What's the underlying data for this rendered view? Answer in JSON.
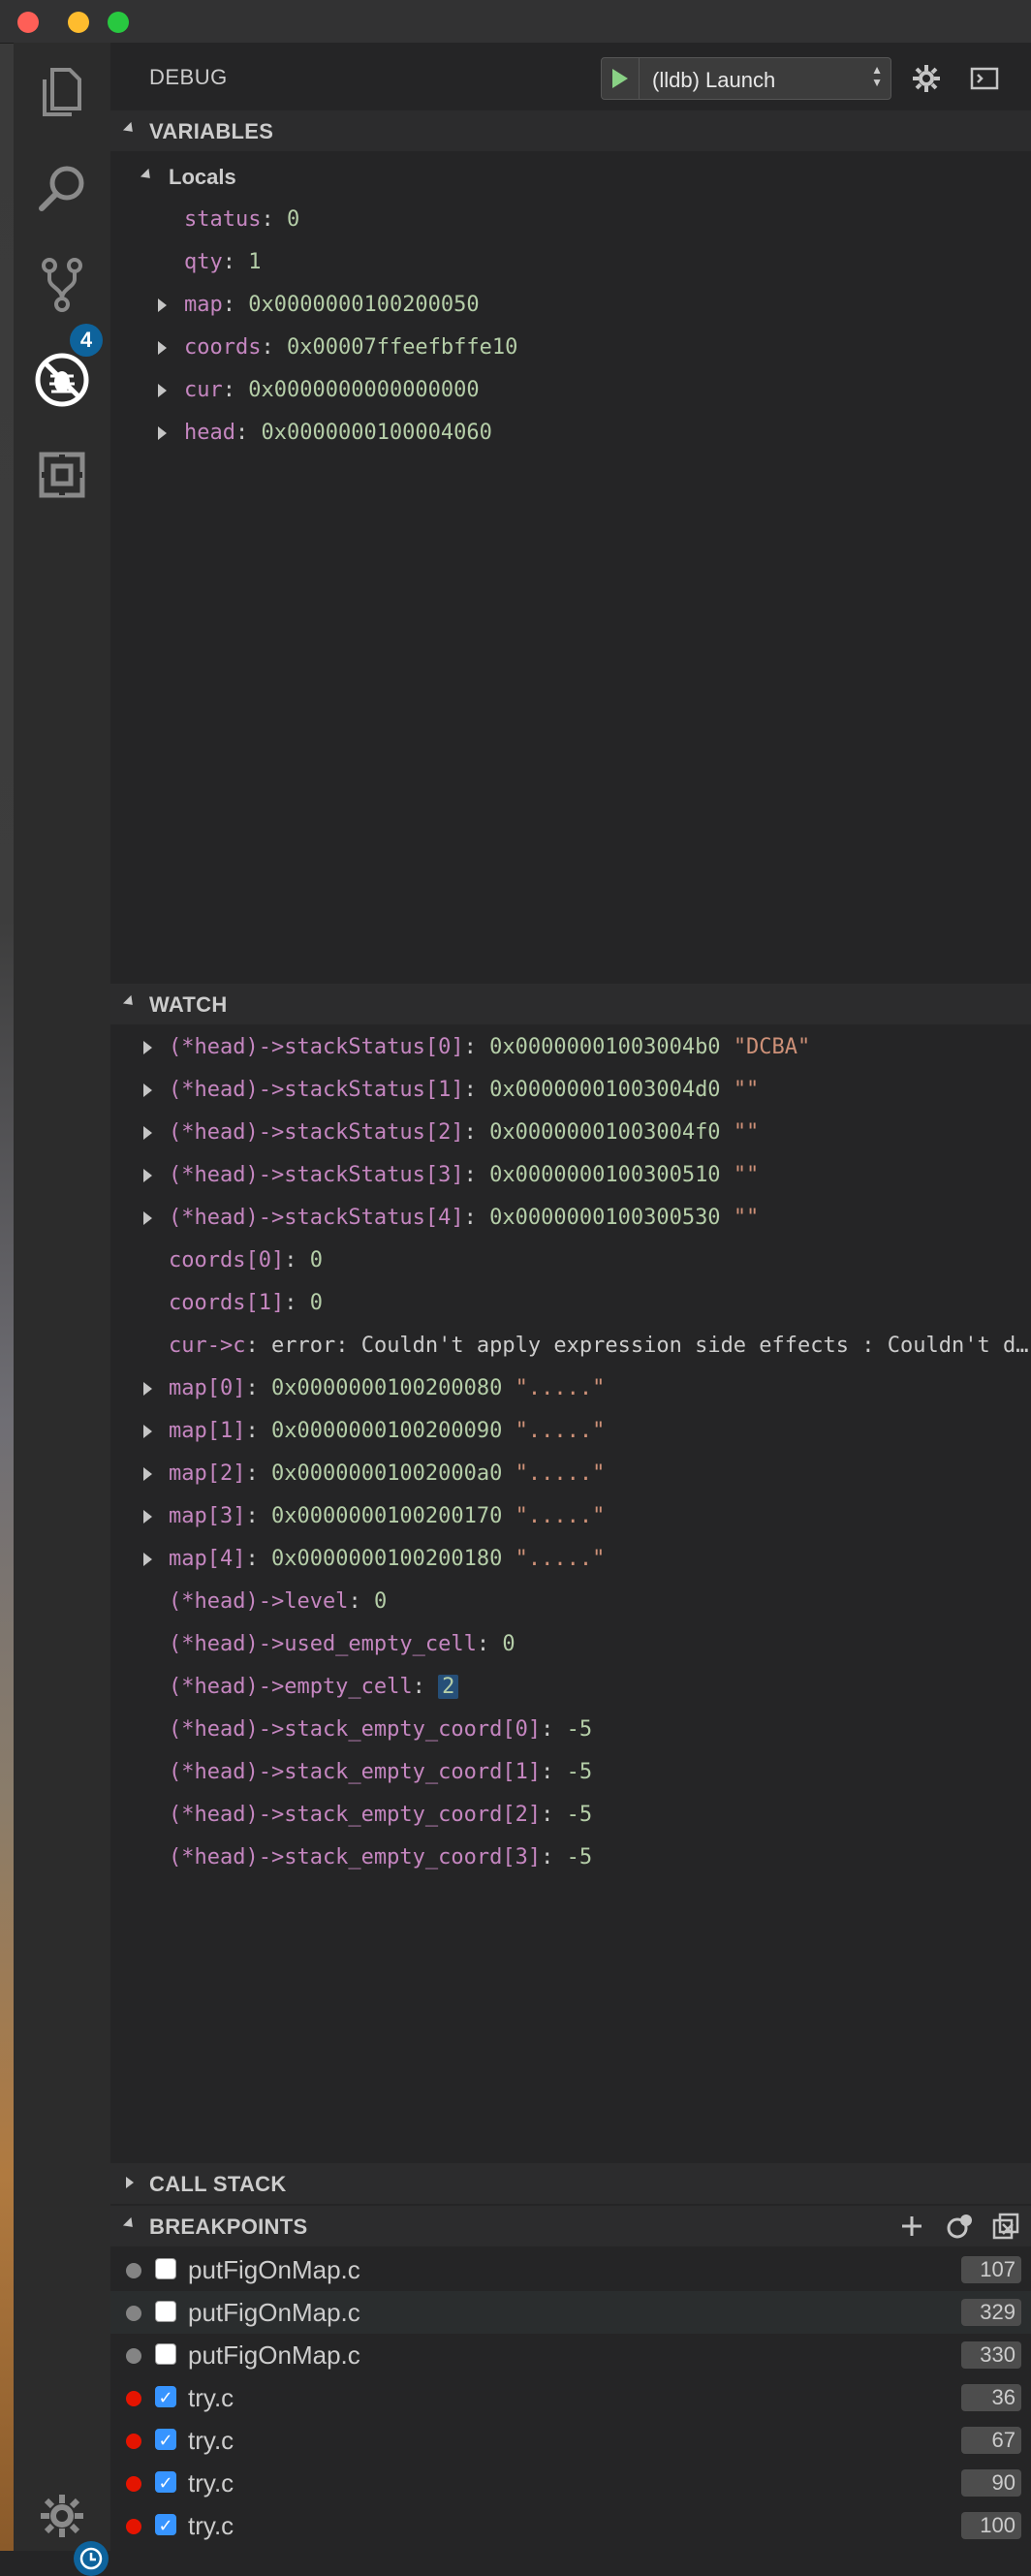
{
  "window": {
    "traffic_lights": [
      "close",
      "minimize",
      "zoom"
    ]
  },
  "activity_bar": {
    "items": [
      {
        "icon": "explorer-files-icon"
      },
      {
        "icon": "search-icon"
      },
      {
        "icon": "source-control-icon",
        "badge": "4"
      },
      {
        "icon": "debug-icon",
        "active": true
      },
      {
        "icon": "extensions-icon"
      }
    ],
    "manage_icon": "gear-icon"
  },
  "debug": {
    "title": "DEBUG",
    "configuration": "(lldb) Launch"
  },
  "variables": {
    "header": "VARIABLES",
    "scope": "Locals",
    "items": [
      {
        "name": "status",
        "value": "0",
        "expandable": false
      },
      {
        "name": "qty",
        "value": "1",
        "expandable": false
      },
      {
        "name": "map",
        "value": "0x0000000100200050",
        "expandable": true
      },
      {
        "name": "coords",
        "value": "0x00007ffeefbffe10",
        "expandable": true
      },
      {
        "name": "cur",
        "value": "0x0000000000000000",
        "expandable": true
      },
      {
        "name": "head",
        "value": "0x0000000100004060",
        "expandable": true
      }
    ]
  },
  "watch": {
    "header": "WATCH",
    "items": [
      {
        "expr": "(*head)->stackStatus[0]",
        "value": "0x00000001003004b0",
        "str": "\"DCBA\"",
        "expandable": true
      },
      {
        "expr": "(*head)->stackStatus[1]",
        "value": "0x00000001003004d0",
        "str": "\"\"",
        "expandable": true
      },
      {
        "expr": "(*head)->stackStatus[2]",
        "value": "0x00000001003004f0",
        "str": "\"\"",
        "expandable": true
      },
      {
        "expr": "(*head)->stackStatus[3]",
        "value": "0x0000000100300510",
        "str": "\"\"",
        "expandable": true
      },
      {
        "expr": "(*head)->stackStatus[4]",
        "value": "0x0000000100300530",
        "str": "\"\"",
        "expandable": true
      },
      {
        "expr": "coords[0]",
        "value": "0",
        "str": "",
        "expandable": false
      },
      {
        "expr": "coords[1]",
        "value": "0",
        "str": "",
        "expandable": false
      },
      {
        "expr": "cur->c",
        "value": "",
        "str": "",
        "error": "error: Couldn't apply expression side effects : Couldn't d…",
        "expandable": false
      },
      {
        "expr": "map[0]",
        "value": "0x0000000100200080",
        "str": "\".....\"",
        "expandable": true
      },
      {
        "expr": "map[1]",
        "value": "0x0000000100200090",
        "str": "\".....\"",
        "expandable": true
      },
      {
        "expr": "map[2]",
        "value": "0x00000001002000a0",
        "str": "\".....\"",
        "expandable": true
      },
      {
        "expr": "map[3]",
        "value": "0x0000000100200170",
        "str": "\".....\"",
        "expandable": true
      },
      {
        "expr": "map[4]",
        "value": "0x0000000100200180",
        "str": "\".....\"",
        "expandable": true
      },
      {
        "expr": "(*head)->level",
        "value": "0",
        "str": "",
        "expandable": false
      },
      {
        "expr": "(*head)->used_empty_cell",
        "value": "0",
        "str": "",
        "expandable": false
      },
      {
        "expr": "(*head)->empty_cell",
        "value": "2",
        "str": "",
        "expandable": false,
        "highlighted": true
      },
      {
        "expr": "(*head)->stack_empty_coord[0]",
        "value": "-5",
        "str": "",
        "expandable": false
      },
      {
        "expr": "(*head)->stack_empty_coord[1]",
        "value": "-5",
        "str": "",
        "expandable": false
      },
      {
        "expr": "(*head)->stack_empty_coord[2]",
        "value": "-5",
        "str": "",
        "expandable": false
      },
      {
        "expr": "(*head)->stack_empty_coord[3]",
        "value": "-5",
        "str": "",
        "expandable": false
      }
    ]
  },
  "call_stack": {
    "header": "CALL STACK"
  },
  "breakpoints": {
    "header": "BREAKPOINTS",
    "items": [
      {
        "file": "putFigOnMap.c",
        "line": "107",
        "enabled": false
      },
      {
        "file": "putFigOnMap.c",
        "line": "329",
        "enabled": false
      },
      {
        "file": "putFigOnMap.c",
        "line": "330",
        "enabled": false
      },
      {
        "file": "try.c",
        "line": "36",
        "enabled": true
      },
      {
        "file": "try.c",
        "line": "67",
        "enabled": true
      },
      {
        "file": "try.c",
        "line": "90",
        "enabled": true
      },
      {
        "file": "try.c",
        "line": "100",
        "enabled": true
      }
    ]
  },
  "colors": {
    "name": "#c586c0",
    "value": "#b5cea8",
    "string": "#ce9178",
    "accent": "#0e639c",
    "bp_enabled": "#e51400",
    "bp_disabled": "#848484"
  }
}
